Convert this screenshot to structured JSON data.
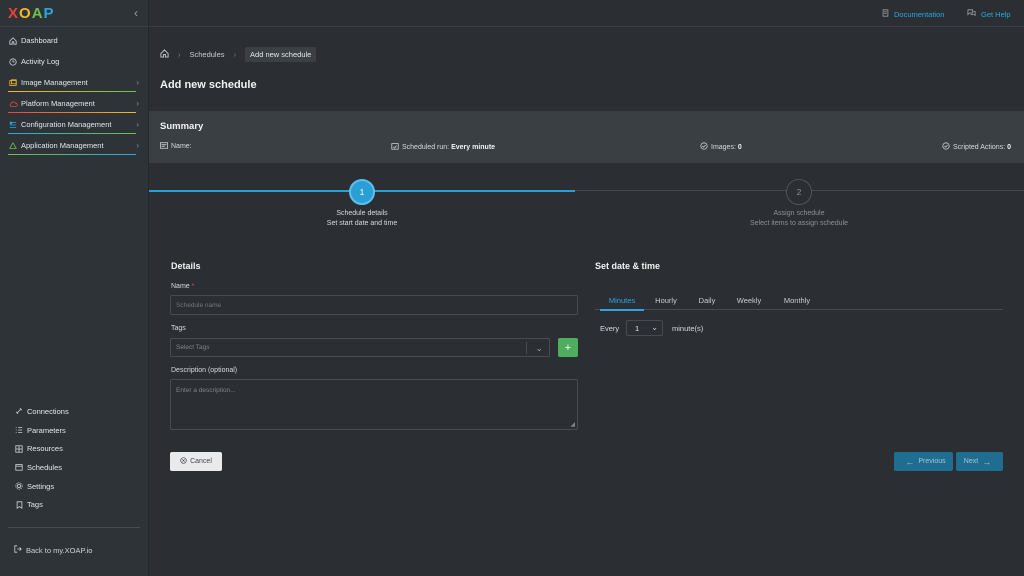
{
  "app": {
    "logo": [
      "X",
      "O",
      "A",
      "P"
    ],
    "collapse_icon": "chevron-left-icon"
  },
  "sidebar": {
    "items": [
      {
        "label": "Dashboard",
        "icon": "home-icon"
      },
      {
        "label": "Activity Log",
        "icon": "clock-icon"
      },
      {
        "label": "Image Management",
        "icon": "image-icon",
        "accent": "#f5b72c"
      },
      {
        "label": "Platform Management",
        "icon": "cloud-icon",
        "accent": "#e6443a"
      },
      {
        "label": "Configuration Management",
        "icon": "config-icon",
        "accent": "#2aa7df"
      },
      {
        "label": "Application Management",
        "icon": "apps-icon",
        "accent": "#6cc04a"
      }
    ],
    "bottom_items": [
      {
        "label": "Connections",
        "icon": "link-icon"
      },
      {
        "label": "Parameters",
        "icon": "list-icon"
      },
      {
        "label": "Resources",
        "icon": "resources-icon"
      },
      {
        "label": "Schedules",
        "icon": "calendar-icon"
      },
      {
        "label": "Settings",
        "icon": "gear-icon"
      },
      {
        "label": "Tags",
        "icon": "bookmark-icon"
      }
    ],
    "back_link": "Back to my.XOAP.io"
  },
  "topbar": {
    "documentation": "Documentation",
    "get_help": "Get Help"
  },
  "breadcrumb": {
    "items": [
      "Schedules",
      "Add new schedule"
    ]
  },
  "page": {
    "title": "Add new schedule"
  },
  "summary": {
    "title": "Summary",
    "name_label": "Name:",
    "name_value": "",
    "scheduled_run_label": "Scheduled run:",
    "scheduled_run_value": "Every minute",
    "images_label": "Images:",
    "images_value": "0",
    "scripted_actions_label": "Scripted Actions:",
    "scripted_actions_value": "0"
  },
  "stepper": {
    "steps": [
      {
        "number": "1",
        "title": "Schedule details",
        "subtitle": "Set start date and time",
        "active": true
      },
      {
        "number": "2",
        "title": "Assign schedule",
        "subtitle": "Select items to assign schedule",
        "active": false
      }
    ]
  },
  "details": {
    "title": "Details",
    "name_label": "Name",
    "name_required": "*",
    "name_placeholder": "Schedule name",
    "tags_label": "Tags",
    "tags_placeholder": "Select Tags",
    "add_tag_label": "+",
    "description_label": "Description (optional)",
    "description_placeholder": "Enter a description..."
  },
  "datetime": {
    "title": "Set date & time",
    "tabs": [
      "Minutes",
      "Hourly",
      "Daily",
      "Weekly",
      "Monthly"
    ],
    "active_tab": "Minutes",
    "every_label": "Every",
    "every_value": "1",
    "unit_label": "minute(s)"
  },
  "actions": {
    "cancel": "Cancel",
    "previous": "Previous",
    "next": "Next"
  },
  "colors": {
    "accent": "#2aa7df",
    "add_button": "#4fae5e",
    "nav_button": "#1f6d91"
  }
}
